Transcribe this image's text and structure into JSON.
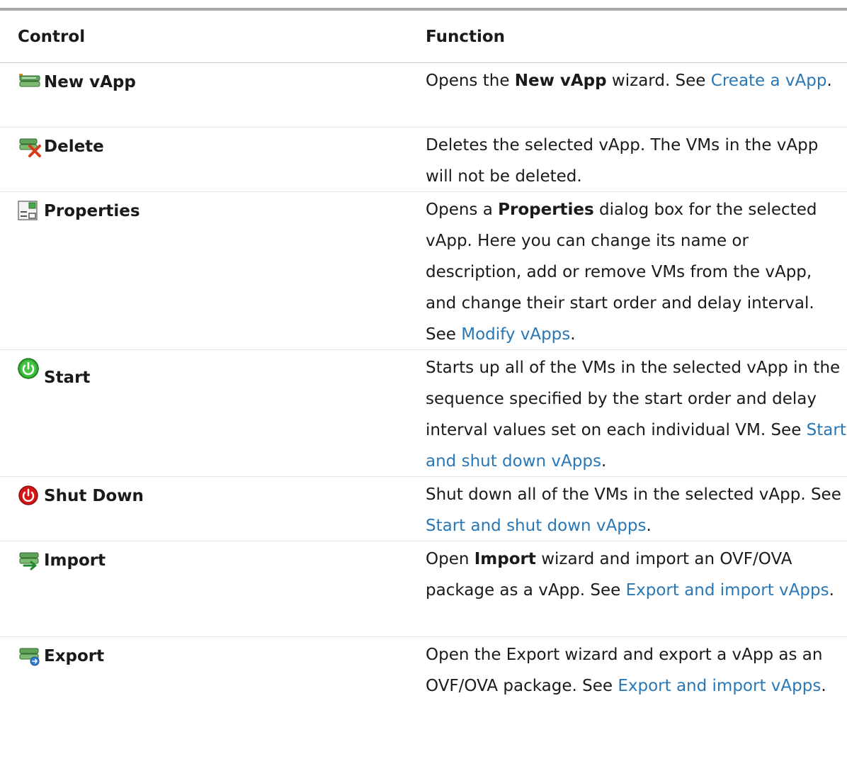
{
  "headers": {
    "control": "Control",
    "function": "Function"
  },
  "rows": [
    {
      "icon": "new-vapp-icon",
      "label": "New vApp",
      "desc": {
        "t1": "Opens the ",
        "b1": "New vApp",
        "t2": " wizard. See ",
        "link": "Create a vApp",
        "t3": "."
      }
    },
    {
      "icon": "delete-vapp-icon",
      "label": "Delete",
      "desc": {
        "t1": "Deletes the selected vApp. The VMs in the vApp will not be deleted."
      }
    },
    {
      "icon": "properties-icon",
      "label": "Properties",
      "desc": {
        "t1": "Opens a ",
        "b1": "Properties",
        "t2": " dialog box for the selected vApp. Here you can change its name or description, add or remove VMs from the vApp, and change their start order and delay interval. See ",
        "link": "Modify vApps",
        "t3": "."
      }
    },
    {
      "icon": "start-power-icon",
      "label": "Start",
      "desc": {
        "t1": "Starts up all of the VMs in the selected vApp in the sequence specified by the start order and delay interval values set on each individual VM. See ",
        "link": "Start and shut down vApps",
        "t3": "."
      }
    },
    {
      "icon": "shutdown-power-icon",
      "label": "Shut Down",
      "desc": {
        "t1": "Shut down all of the VMs in the selected vApp. See ",
        "link": "Start and shut down vApps",
        "t3": "."
      }
    },
    {
      "icon": "import-vapp-icon",
      "label": "Import",
      "desc": {
        "t1": "Open ",
        "b1": "Import",
        "t2": " wizard and import an OVF/OVA package as a vApp. See ",
        "link": "Export and import vApps",
        "t3": "."
      }
    },
    {
      "icon": "export-vapp-icon",
      "label": "Export",
      "desc": {
        "t1": "Open the Export wizard and export a vApp as an OVF/OVA package. See ",
        "link": "Export and import vApps",
        "t3": "."
      }
    }
  ],
  "colors": {
    "link": "#2a77b5",
    "rule_top": "#a9a9a9",
    "start_green": "#2fae2f",
    "shutdown_red": "#d41616"
  }
}
